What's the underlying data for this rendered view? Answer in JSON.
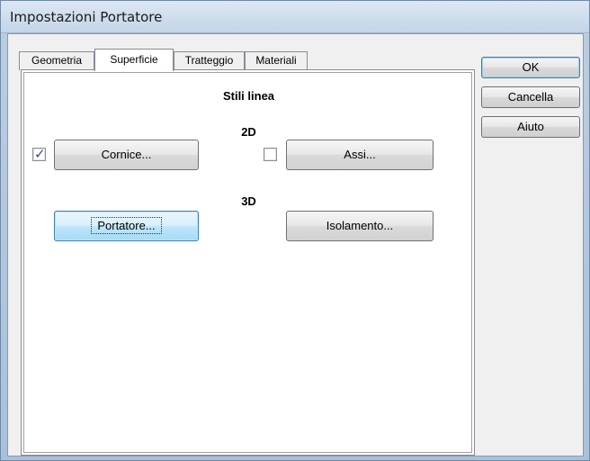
{
  "window": {
    "title": "Impostazioni Portatore"
  },
  "tabs": [
    {
      "label": "Geometria",
      "active": false
    },
    {
      "label": "Superficie",
      "active": true
    },
    {
      "label": "Tratteggio",
      "active": false
    },
    {
      "label": "Materiali",
      "active": false
    }
  ],
  "panel": {
    "heading": "Stili linea",
    "section_2d": "2D",
    "section_3d": "3D",
    "cornice": {
      "label": "Cornice...",
      "checked": true
    },
    "assi": {
      "label": "Assi...",
      "checked": false
    },
    "portatore": {
      "label": "Portatore..."
    },
    "isolamento": {
      "label": "Isolamento..."
    }
  },
  "side_buttons": {
    "ok": "OK",
    "cancel": "Cancella",
    "help": "Aiuto"
  },
  "colors": {
    "accent": "#3c7fb1",
    "check": "#2b4f9e"
  }
}
